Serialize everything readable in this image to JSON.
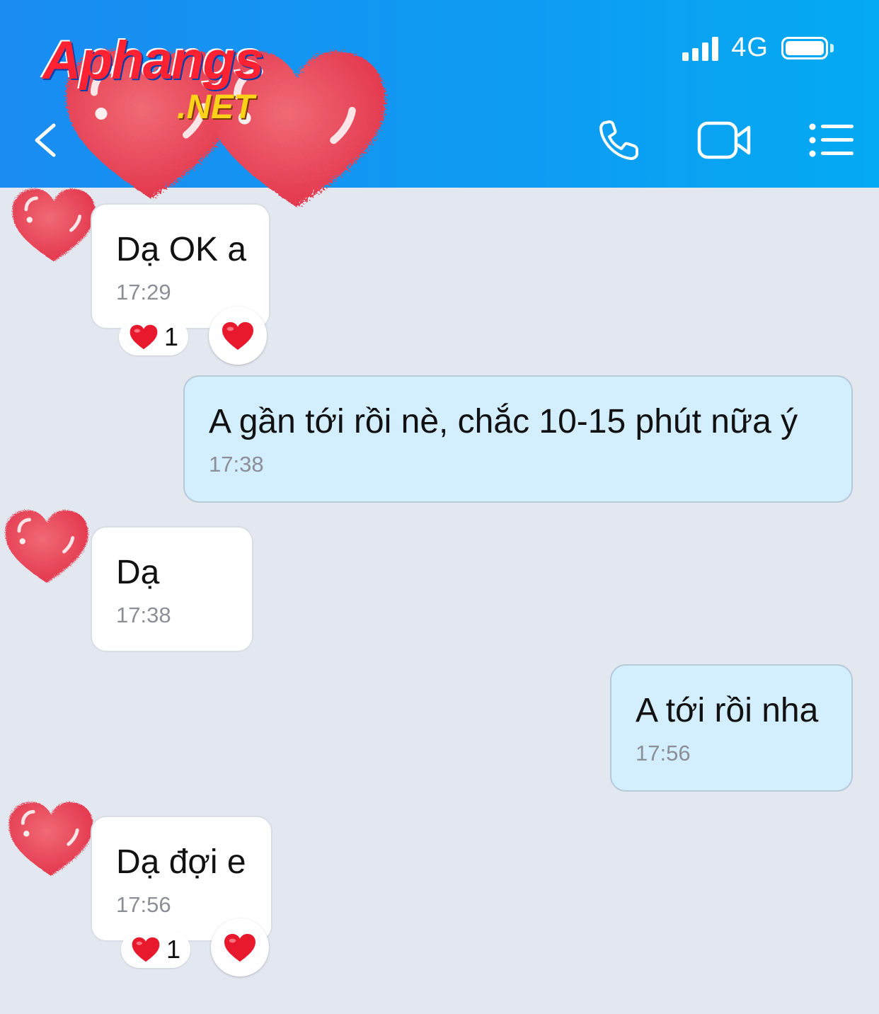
{
  "status_bar": {
    "network": "4G"
  },
  "watermark": {
    "brand": "Aphangs",
    "suffix": ".NET"
  },
  "header": {
    "back_icon": "chevron-left-icon",
    "actions": [
      "phone-icon",
      "video-camera-icon",
      "list-menu-icon"
    ]
  },
  "messages": [
    {
      "direction": "incoming",
      "text": "Dạ OK a",
      "time": "17:29",
      "reaction_count": "1"
    },
    {
      "direction": "outgoing",
      "text": "A gần tới rồi nè, chắc 10-15 phút nữa ý",
      "time": "17:38"
    },
    {
      "direction": "incoming",
      "text": "Dạ",
      "time": "17:38"
    },
    {
      "direction": "outgoing",
      "text": "A tới rồi nha",
      "time": "17:56"
    },
    {
      "direction": "incoming",
      "text": "Dạ đợi e",
      "time": "17:56",
      "reaction_count": "1"
    }
  ],
  "colors": {
    "header_start": "#1a8cf2",
    "header_end": "#04aaf2",
    "chat_background": "#e3e7f0",
    "outgoing_bubble": "#d3eeff",
    "incoming_bubble": "#ffffff",
    "heart": "#e8203a"
  }
}
